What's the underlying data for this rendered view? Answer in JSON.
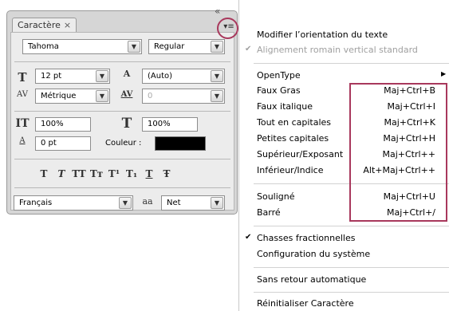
{
  "panel": {
    "tab_label": "Caractère",
    "tab_close": "×",
    "collapse_glyph": "«",
    "menu_glyph": "▾≡",
    "font_family": "Tahoma",
    "font_style": "Regular",
    "font_size": "12 pt",
    "leading": "(Auto)",
    "kerning": "Métrique",
    "tracking": "0",
    "vertical_scale": "100%",
    "horizontal_scale": "100%",
    "baseline_shift": "0 pt",
    "color_label": "Couleur :",
    "color_value": "#000000",
    "language": "Français",
    "anti_aliasing": "Net",
    "icons": {
      "font_size": "T",
      "leading": "A",
      "kerning": "AV",
      "tracking": "AV",
      "vertical_scale": "IT",
      "horizontal_scale": "T",
      "baseline_shift": "A",
      "aa": "aa"
    },
    "style_buttons": [
      "T",
      "T",
      "TT",
      "Tт",
      "T¹",
      "T₁",
      "T",
      "Ŧ"
    ]
  },
  "menu": {
    "items": [
      {
        "label": "Modifier l’orientation du texte",
        "shortcut": "",
        "checked": false,
        "disabled": false
      },
      {
        "label": "Alignement romain vertical standard",
        "shortcut": "",
        "checked": true,
        "disabled": true
      },
      {
        "label": "OpenType",
        "shortcut": "",
        "checked": false,
        "disabled": false,
        "submenu": true
      },
      {
        "label": "Faux Gras",
        "shortcut": "Maj+Ctrl+B",
        "checked": false,
        "disabled": false
      },
      {
        "label": "Faux italique",
        "shortcut": "Maj+Ctrl+I",
        "checked": false,
        "disabled": false
      },
      {
        "label": "Tout en capitales",
        "shortcut": "Maj+Ctrl+K",
        "checked": false,
        "disabled": false
      },
      {
        "label": "Petites capitales",
        "shortcut": "Maj+Ctrl+H",
        "checked": false,
        "disabled": false
      },
      {
        "label": "Supérieur/Exposant",
        "shortcut": "Maj+Ctrl++",
        "checked": false,
        "disabled": false
      },
      {
        "label": "Inférieur/Indice",
        "shortcut": "Alt+Maj+Ctrl++",
        "checked": false,
        "disabled": false
      },
      {
        "label": "Souligné",
        "shortcut": "Maj+Ctrl+U",
        "checked": false,
        "disabled": false
      },
      {
        "label": "Barré",
        "shortcut": "Maj+Ctrl+/",
        "checked": false,
        "disabled": false
      },
      {
        "label": "Chasses fractionnelles",
        "shortcut": "",
        "checked": true,
        "disabled": false
      },
      {
        "label": "Configuration du système",
        "shortcut": "",
        "checked": false,
        "disabled": false
      },
      {
        "label": "Sans retour automatique",
        "shortcut": "",
        "checked": false,
        "disabled": false
      },
      {
        "label": "Réinitialiser Caractère",
        "shortcut": "",
        "checked": false,
        "disabled": false
      }
    ],
    "check_glyph": "✔",
    "submenu_glyph": "▶"
  },
  "colors": {
    "highlight": "#a8385c",
    "panel_bg": "#d6d6d6",
    "panel_inner": "#ececec"
  }
}
